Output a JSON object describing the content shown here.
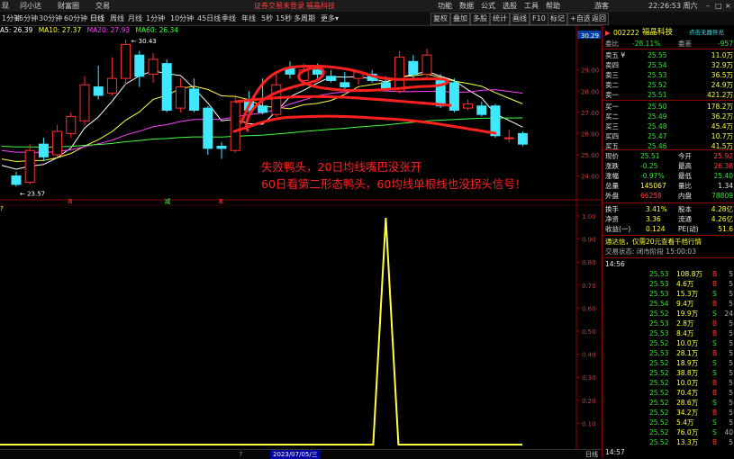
{
  "menubar": {
    "items": [
      "现",
      "问小达",
      "财富圈",
      "交易"
    ],
    "login_status": "证券交易未登录",
    "stock_short": "福晶科技",
    "right_items": [
      "功能",
      "数据",
      "公式",
      "选股",
      "工具",
      "帮助",
      "游客"
    ],
    "time": "22:26:53 周六",
    "win_buttons": [
      "–",
      "□",
      "×"
    ]
  },
  "toolbar": {
    "timeframes": [
      "1分钟",
      "15分钟",
      "30分钟",
      "60分钟",
      "日线",
      "周线",
      "月线",
      "1分钟",
      "10分钟",
      "45日线",
      "季线",
      "年线",
      "5秒",
      "15秒",
      "多周期",
      "更多"
    ],
    "active_index": 4,
    "right_buttons": [
      "复权",
      "叠加",
      "多股",
      "统计",
      "画线",
      "F10",
      "标记",
      "+自选",
      "返回"
    ]
  },
  "ma_legend": [
    {
      "label": "A5: 26.39",
      "color": "#ffffff"
    },
    {
      "label": "MA10: 27.37",
      "color": "#ffff40"
    },
    {
      "label": "MA20: 27.93",
      "color": "#ff40ff"
    },
    {
      "label": "MA60: 26.34",
      "color": "#40ff40"
    }
  ],
  "price_axis": [
    "30.29",
    "29.00",
    "28.00",
    "27.00",
    "26.00",
    "25.00",
    "24.00"
  ],
  "indicator_axis": [
    "1.00",
    "0.90",
    "0.80",
    "0.70",
    "0.60",
    "0.50",
    "0.40",
    "0.30",
    "0.20",
    "0.10"
  ],
  "candles": [
    {
      "o": 24.0,
      "c": 23.6,
      "h": 24.2,
      "l": 23.5
    },
    {
      "o": 23.7,
      "c": 25.2,
      "h": 25.5,
      "l": 23.6
    },
    {
      "o": 25.5,
      "c": 24.9,
      "h": 25.8,
      "l": 24.7
    },
    {
      "o": 25.0,
      "c": 26.1,
      "h": 26.4,
      "l": 24.9
    },
    {
      "o": 26.0,
      "c": 26.8,
      "h": 27.0,
      "l": 25.8
    },
    {
      "o": 26.6,
      "c": 28.3,
      "h": 28.7,
      "l": 26.4
    },
    {
      "o": 28.2,
      "c": 27.8,
      "h": 29.2,
      "l": 27.6
    },
    {
      "o": 27.9,
      "c": 28.6,
      "h": 29.6,
      "l": 27.8
    },
    {
      "o": 28.6,
      "c": 30.2,
      "h": 30.43,
      "l": 28.3
    },
    {
      "o": 29.7,
      "c": 28.7,
      "h": 29.9,
      "l": 28.2
    },
    {
      "o": 28.8,
      "c": 29.5,
      "h": 29.8,
      "l": 28.4
    },
    {
      "o": 29.3,
      "c": 27.1,
      "h": 29.5,
      "l": 27.0
    },
    {
      "o": 27.2,
      "c": 28.2,
      "h": 28.6,
      "l": 27.0
    },
    {
      "o": 28.1,
      "c": 27.1,
      "h": 28.6,
      "l": 27.0
    },
    {
      "o": 27.2,
      "c": 25.3,
      "h": 27.3,
      "l": 25.0
    },
    {
      "o": 25.4,
      "c": 25.3,
      "h": 25.6,
      "l": 24.8
    },
    {
      "o": 25.2,
      "c": 27.5,
      "h": 27.8,
      "l": 25.1
    },
    {
      "o": 27.6,
      "c": 27.1,
      "h": 28.0,
      "l": 27.0
    },
    {
      "o": 27.3,
      "c": 27.0,
      "h": 28.6,
      "l": 26.9
    },
    {
      "o": 26.9,
      "c": 28.3,
      "h": 28.8,
      "l": 26.8
    },
    {
      "o": 29.1,
      "c": 28.8,
      "h": 29.4,
      "l": 28.6
    },
    {
      "o": 28.5,
      "c": 29.0,
      "h": 29.3,
      "l": 28.3
    },
    {
      "o": 29.0,
      "c": 28.8,
      "h": 29.3,
      "l": 28.6
    },
    {
      "o": 28.7,
      "c": 28.5,
      "h": 29.0,
      "l": 28.4
    },
    {
      "o": 28.4,
      "c": 28.2,
      "h": 28.9,
      "l": 28.1
    },
    {
      "o": 28.6,
      "c": 28.9,
      "h": 29.0,
      "l": 28.3
    },
    {
      "o": 28.8,
      "c": 28.5,
      "h": 29.0,
      "l": 28.4
    },
    {
      "o": 28.4,
      "c": 28.1,
      "h": 28.7,
      "l": 28.0
    },
    {
      "o": 28.0,
      "c": 29.6,
      "h": 29.9,
      "l": 27.9
    },
    {
      "o": 29.4,
      "c": 28.8,
      "h": 29.7,
      "l": 28.6
    },
    {
      "o": 28.8,
      "c": 29.7,
      "h": 30.0,
      "l": 28.6
    },
    {
      "o": 28.6,
      "c": 27.3,
      "h": 28.8,
      "l": 27.2
    },
    {
      "o": 28.4,
      "c": 27.1,
      "h": 28.6,
      "l": 27.0
    },
    {
      "o": 27.2,
      "c": 27.4,
      "h": 27.6,
      "l": 27.1
    },
    {
      "o": 27.3,
      "c": 26.9,
      "h": 27.5,
      "l": 26.8
    },
    {
      "o": 27.3,
      "c": 25.9,
      "h": 27.4,
      "l": 25.8
    },
    {
      "o": 25.8,
      "c": 25.8,
      "h": 26.2,
      "l": 25.6
    },
    {
      "o": 26.0,
      "c": 25.5,
      "h": 26.1,
      "l": 25.4
    }
  ],
  "price_labels": {
    "high": "30.43",
    "low": "23.57"
  },
  "signal_marks": [
    {
      "t": "B",
      "color": "#ff4040"
    },
    {
      "t": "减",
      "color": "#40ff40"
    },
    {
      "t": "B",
      "color": "#ff4040"
    }
  ],
  "annotation": {
    "line1": "失败鸭头，20日均线嘴巴没张开",
    "line2": "60日看第二形态鸭头，60均线单根线也没拐头信号！"
  },
  "indicator_tag": "?",
  "date_bar": "2023/07/05/三",
  "bottom_left_mark": "7",
  "bottom_right_tab": "日线",
  "quote": {
    "code": "002222",
    "name": "福晶科技",
    "source": "点击无器件光",
    "webi_label": "委比",
    "webi_val": "-28.11%",
    "wecha_label": "委差",
    "wecha_val": "-957",
    "asks": [
      {
        "l": "卖五 ¥",
        "p": "25.55",
        "v": "11.0万"
      },
      {
        "l": "卖四",
        "p": "25.54",
        "v": "32.9万"
      },
      {
        "l": "卖三",
        "p": "25.53",
        "v": "36.5万"
      },
      {
        "l": "卖二",
        "p": "25.52",
        "v": "24.9万"
      },
      {
        "l": "卖一",
        "p": "25.51",
        "v": "421.2万"
      }
    ],
    "bids": [
      {
        "l": "买一",
        "p": "25.50",
        "v": "178.2万"
      },
      {
        "l": "买二",
        "p": "25.49",
        "v": "36.2万"
      },
      {
        "l": "买三",
        "p": "25.48",
        "v": "45.4万"
      },
      {
        "l": "买四",
        "p": "25.47",
        "v": "10.7万"
      },
      {
        "l": "买五",
        "p": "25.46",
        "v": "41.5万"
      }
    ],
    "stats": [
      {
        "a": "现价",
        "av": "25.51",
        "b": "今开",
        "bv": "25.92"
      },
      {
        "a": "涨跌",
        "av": "-0.25",
        "b": "最高",
        "bv": "26.38"
      },
      {
        "a": "涨幅",
        "av": "-0.97%",
        "b": "最低",
        "bv": "25.40"
      },
      {
        "a": "总量",
        "av": "145067",
        "b": "量比",
        "bv": "1.34"
      },
      {
        "a": "外盘",
        "av": "66258",
        "b": "内盘",
        "bv": "78809"
      }
    ],
    "stats2": [
      {
        "a": "换手",
        "av": "3.41%",
        "b": "股本",
        "bv": "4.28亿"
      },
      {
        "a": "净资",
        "av": "3.36",
        "b": "流通",
        "bv": "4.26亿"
      },
      {
        "a": "收益(一)",
        "av": "0.124",
        "b": "PE(动)",
        "bv": "51.6"
      }
    ],
    "promo": "通达信，仅需20元查看千档行情",
    "trade_status": "交易状态: 闭市阶段 15:00:03",
    "first_time": "14:56",
    "ticks": [
      {
        "p": "25.53",
        "v": "108.8万",
        "d": "B",
        "n": "5"
      },
      {
        "p": "25.53",
        "v": "4.6万",
        "d": "B",
        "n": "5"
      },
      {
        "p": "25.53",
        "v": "15.3万",
        "d": "S",
        "n": "5"
      },
      {
        "p": "25.54",
        "v": "9.4万",
        "d": "B",
        "n": "5"
      },
      {
        "p": "25.52",
        "v": "19.9万",
        "d": "S",
        "n": "24"
      },
      {
        "p": "25.53",
        "v": "2.8万",
        "d": "B",
        "n": "5"
      },
      {
        "p": "25.53",
        "v": "8.4万",
        "d": "B",
        "n": "5"
      },
      {
        "p": "25.52",
        "v": "10.0万",
        "d": "S",
        "n": "5"
      },
      {
        "p": "25.53",
        "v": "28.1万",
        "d": "B",
        "n": "5"
      },
      {
        "p": "25.52",
        "v": "18.9万",
        "d": "S",
        "n": "5"
      },
      {
        "p": "25.52",
        "v": "38.8万",
        "d": "S",
        "n": "5"
      },
      {
        "p": "25.52",
        "v": "10.0万",
        "d": "B",
        "n": "5"
      },
      {
        "p": "25.52",
        "v": "70.4万",
        "d": "B",
        "n": "5"
      },
      {
        "p": "25.52",
        "v": "28.6万",
        "d": "S",
        "n": "5"
      },
      {
        "p": "25.52",
        "v": "34.2万",
        "d": "B",
        "n": "5"
      },
      {
        "p": "25.52",
        "v": "5.4万",
        "d": "S",
        "n": "5"
      },
      {
        "p": "25.52",
        "v": "76.0万",
        "d": "S",
        "n": "40"
      },
      {
        "p": "25.52",
        "v": "13.3万",
        "d": "B",
        "n": "5"
      }
    ],
    "last_time": "14:57"
  }
}
